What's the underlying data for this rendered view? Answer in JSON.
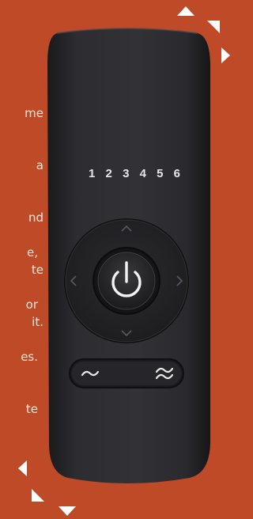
{
  "background": {
    "color": "#bf4a28",
    "text_lines_1": [
      "me",
      "a",
      "nd",
      "te",
      "it."
    ],
    "text_lines_2": [
      "e,",
      "or",
      "es.",
      "te"
    ]
  },
  "remote": {
    "body_color": "#2a2a2e",
    "preset_labels": [
      "1",
      "2",
      "3",
      "4",
      "5",
      "6"
    ],
    "icons": {
      "power": "power-icon",
      "up": "chevron-up-icon",
      "down": "chevron-down-icon",
      "left": "chevron-left-icon",
      "right": "chevron-right-icon",
      "wave_low": "tilde-wave-icon",
      "wave_high": "double-wave-icon"
    }
  }
}
